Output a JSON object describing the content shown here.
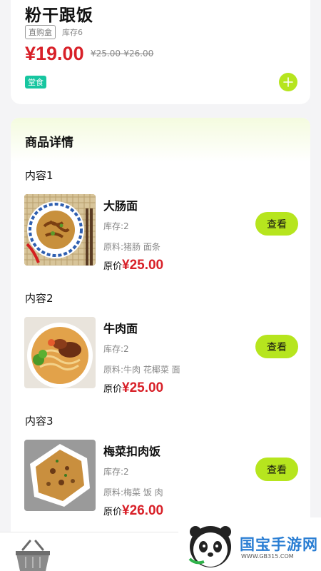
{
  "product": {
    "title": "粉干跟饭",
    "tag": "直购盒",
    "stock": "库存6",
    "price": "¥19.00",
    "price_range": "¥25.00-¥26.00",
    "badge": "堂食"
  },
  "detail": {
    "header": "商品详情",
    "sections": [
      {
        "title": "内容1",
        "name": "大肠面",
        "stock": "库存:2",
        "ingredients": "原料:猪肠 面条",
        "orig_label": "原价",
        "orig_price": "¥25.00",
        "button": "查看"
      },
      {
        "title": "内容2",
        "name": "牛肉面",
        "stock": "库存:2",
        "ingredients": "原料:牛肉 花椰菜 面",
        "orig_label": "原价",
        "orig_price": "¥25.00",
        "button": "查看"
      },
      {
        "title": "内容3",
        "name": "梅菜扣肉饭",
        "stock": "库存:2",
        "ingredients": "原料:梅菜 饭 肉",
        "orig_label": "原价",
        "orig_price": "¥26.00",
        "button": "查看"
      }
    ]
  },
  "watermark": {
    "text": "国宝手游网",
    "sub": "WWW.GB315.COM"
  },
  "colors": {
    "accent": "#b6e51e",
    "price": "#d82028",
    "badge": "#17c6a0"
  }
}
